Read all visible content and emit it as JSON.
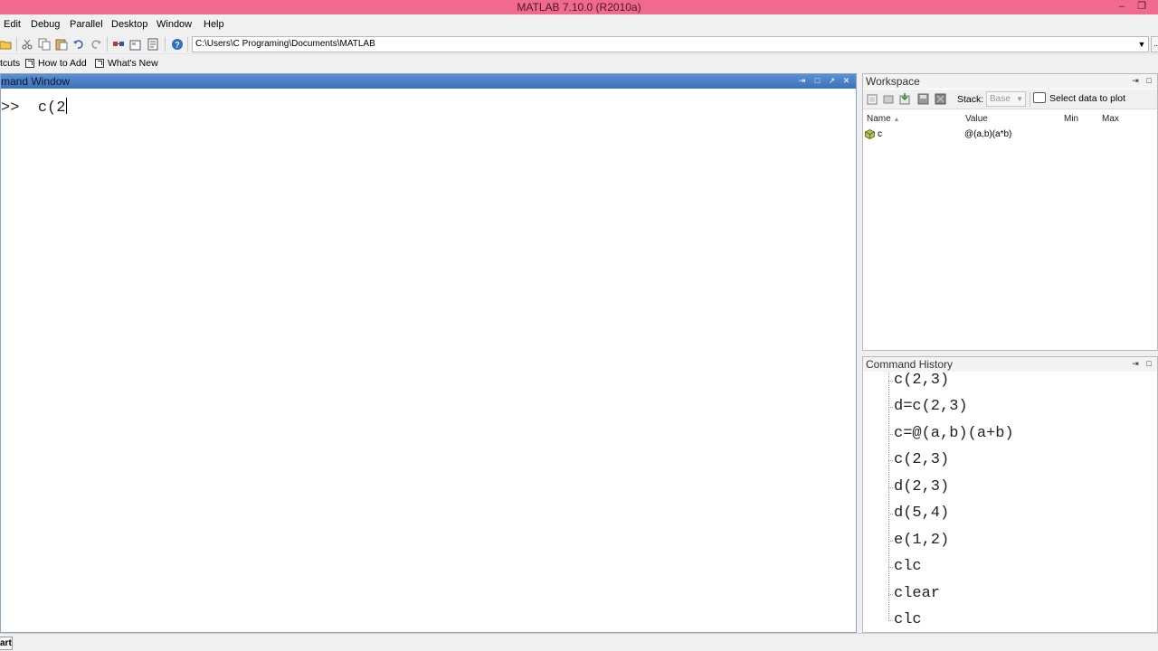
{
  "app": {
    "title": "MATLAB  7.10.0 (R2010a)"
  },
  "menu": {
    "edit": "Edit",
    "debug": "Debug",
    "parallel": "Parallel",
    "desktop": "Desktop",
    "window": "Window",
    "help": "Help"
  },
  "toolbar": {
    "current_folder": "C:\\Users\\C Programing\\Documents\\MATLAB",
    "browse": "..."
  },
  "shortcuts": {
    "shortcuts_label": "tcuts",
    "how_to_add": "How to Add",
    "whats_new": "What's New"
  },
  "command_window": {
    "title": "mand Window",
    "prompt": ">>",
    "input": "c(2"
  },
  "workspace": {
    "title": "Workspace",
    "stack_label": "Stack:",
    "stack_value": "Base",
    "select_data_to_plot": "Select data to plot",
    "columns": [
      "Name",
      "Value",
      "Min",
      "Max"
    ],
    "rows": [
      {
        "name": "c",
        "value": "@(a,b)(a*b)",
        "icon": "function-handle-icon"
      }
    ]
  },
  "history": {
    "title": "Command History",
    "items": [
      "c(2,3)",
      "d=c(2,3)",
      "c=@(a,b)(a+b)",
      "c(2,3)",
      "d(2,3)",
      "d(5,4)",
      "e(1,2)",
      "clc",
      "clear",
      "clc"
    ]
  },
  "status": {
    "start": "art"
  },
  "colors": {
    "titlebar": "#f06a8f",
    "command_header": "#3a72bd"
  }
}
